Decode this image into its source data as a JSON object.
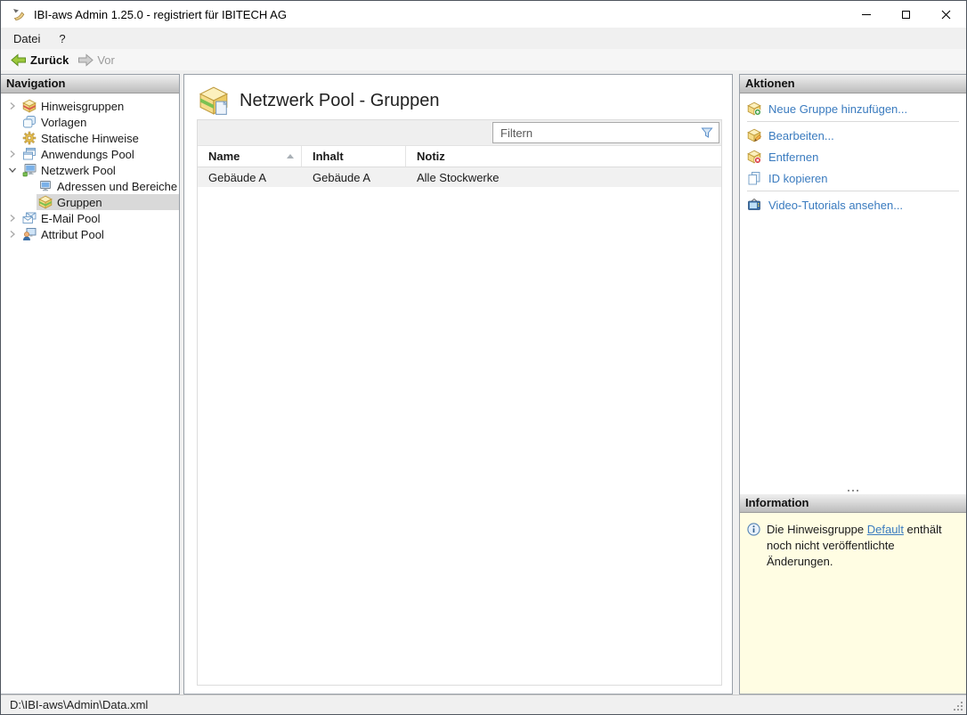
{
  "window": {
    "title": "IBI-aws Admin 1.25.0 - registriert für IBITECH AG",
    "controls": {
      "minimize": "minimize",
      "maximize": "maximize",
      "close": "close"
    }
  },
  "menubar": {
    "items": [
      "Datei",
      "?"
    ]
  },
  "toolbar": {
    "back": "Zurück",
    "forward": "Vor",
    "forward_enabled": false
  },
  "navigation": {
    "header": "Navigation",
    "items": [
      {
        "label": "Hinweisgruppen",
        "icon": "hinweisgruppen-icon",
        "level": 0,
        "expand": "collapsed",
        "selected": false
      },
      {
        "label": "Vorlagen",
        "icon": "vorlagen-icon",
        "level": 0,
        "expand": "none",
        "selected": false
      },
      {
        "label": "Statische Hinweise",
        "icon": "statische-hinweise-icon",
        "level": 0,
        "expand": "none",
        "selected": false
      },
      {
        "label": "Anwendungs Pool",
        "icon": "anwendungs-pool-icon",
        "level": 0,
        "expand": "collapsed",
        "selected": false
      },
      {
        "label": "Netzwerk Pool",
        "icon": "netzwerk-pool-icon",
        "level": 0,
        "expand": "expanded",
        "selected": false
      },
      {
        "label": "Adressen und Bereiche",
        "icon": "adressen-icon",
        "level": 1,
        "expand": "none",
        "selected": false
      },
      {
        "label": "Gruppen",
        "icon": "gruppen-icon",
        "level": 1,
        "expand": "none",
        "selected": true
      },
      {
        "label": "E-Mail Pool",
        "icon": "email-pool-icon",
        "level": 0,
        "expand": "collapsed",
        "selected": false
      },
      {
        "label": "Attribut Pool",
        "icon": "attribut-pool-icon",
        "level": 0,
        "expand": "collapsed",
        "selected": false
      }
    ]
  },
  "main": {
    "title": "Netzwerk Pool - Gruppen",
    "filter": {
      "placeholder": "Filtern"
    },
    "table": {
      "columns": [
        {
          "label": "Name",
          "sorted": "asc"
        },
        {
          "label": "Inhalt",
          "sorted": "none"
        },
        {
          "label": "Notiz",
          "sorted": "none"
        }
      ],
      "rows": [
        {
          "name": "Gebäude A",
          "inhalt": "Gebäude A",
          "notiz": "Alle Stockwerke"
        }
      ]
    }
  },
  "actions": {
    "header": "Aktionen",
    "items": [
      {
        "label": "Neue Gruppe hinzufügen...",
        "icon": "add-group-icon"
      },
      {
        "label": "Bearbeiten...",
        "icon": "edit-group-icon"
      },
      {
        "label": "Entfernen",
        "icon": "remove-group-icon"
      },
      {
        "label": "ID kopieren",
        "icon": "copy-id-icon"
      },
      {
        "label": "Video-Tutorials ansehen...",
        "icon": "video-tutorials-icon"
      }
    ]
  },
  "information": {
    "header": "Information",
    "text_before": "Die Hinweisgruppe ",
    "link_label": "Default",
    "text_after": " enthält noch nicht veröffentlichte Änderungen."
  },
  "statusbar": {
    "path": "D:\\IBI-aws\\Admin\\Data.xml"
  },
  "colors": {
    "link_blue": "#3a7bbf",
    "info_background": "#fffde3",
    "selection_gray": "#d9d9d9",
    "back_arrow_green": "#9dc93c",
    "panel_header_gradient_top": "#efefef",
    "panel_header_gradient_bottom": "#bcbcbc"
  }
}
